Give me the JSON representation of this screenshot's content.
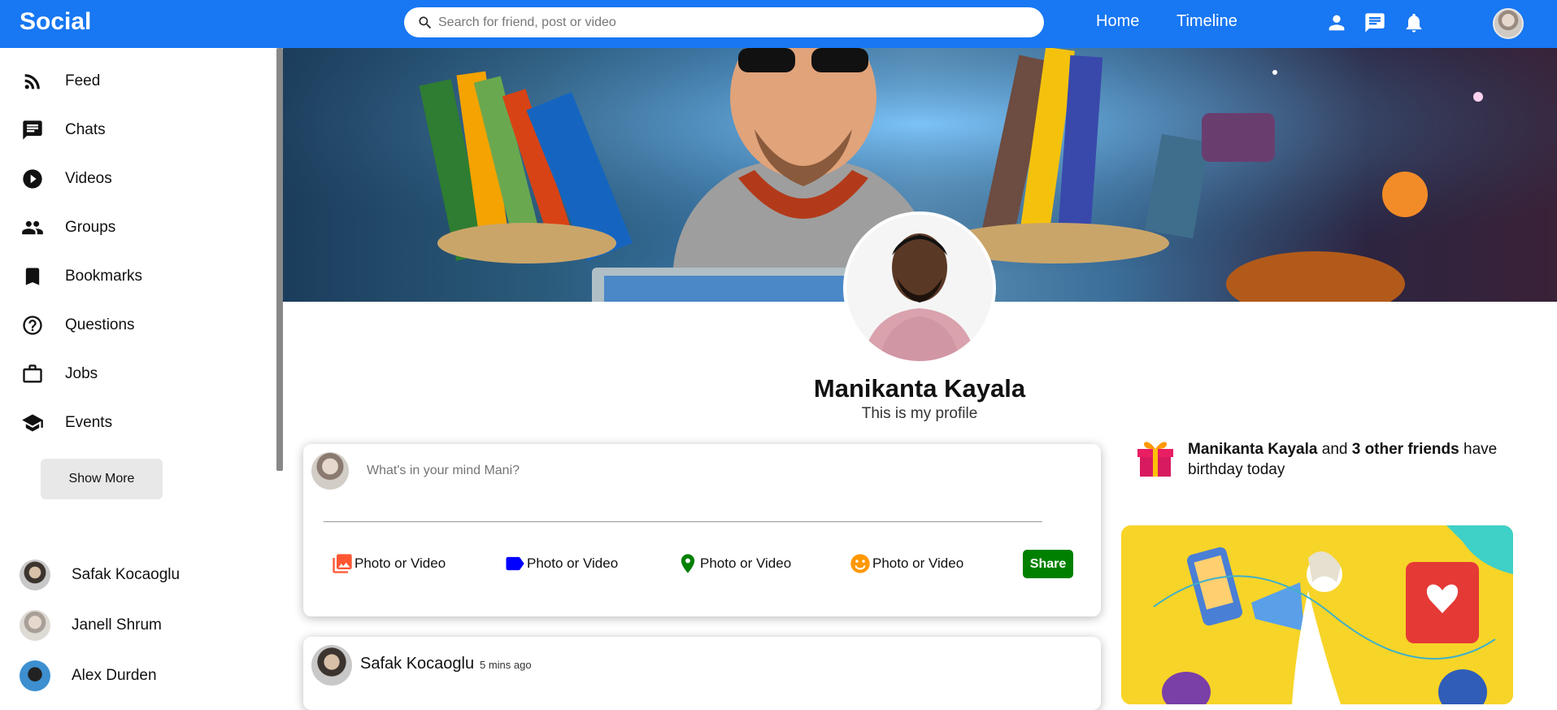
{
  "app": {
    "logo": "Social",
    "search_placeholder": "Search for friend, post or video",
    "nav": {
      "home": "Home",
      "timeline": "Timeline"
    }
  },
  "sidebar": {
    "items": [
      {
        "label": "Feed",
        "icon": "rss-feed-icon"
      },
      {
        "label": "Chats",
        "icon": "chat-icon"
      },
      {
        "label": "Videos",
        "icon": "play-circle-icon"
      },
      {
        "label": "Groups",
        "icon": "group-icon"
      },
      {
        "label": "Bookmarks",
        "icon": "bookmark-icon"
      },
      {
        "label": "Questions",
        "icon": "help-circle-icon"
      },
      {
        "label": "Jobs",
        "icon": "briefcase-icon"
      },
      {
        "label": "Events",
        "icon": "school-icon"
      }
    ],
    "show_more": "Show More",
    "friends": [
      {
        "name": "Safak Kocaoglu"
      },
      {
        "name": "Janell Shrum"
      },
      {
        "name": "Alex Durden"
      }
    ]
  },
  "profile": {
    "name": "Manikanta Kayala",
    "description": "This is my profile"
  },
  "share": {
    "placeholder": "What's in your mind Mani?",
    "options": [
      {
        "label": "Photo or Video",
        "icon": "photo-library-icon",
        "color": "#ff5733"
      },
      {
        "label": "Photo or Video",
        "icon": "label-icon",
        "color": "#0000ff"
      },
      {
        "label": "Photo or Video",
        "icon": "location-pin-icon",
        "color": "#008000"
      },
      {
        "label": "Photo or Video",
        "icon": "emoji-icon",
        "color": "#ff9800"
      }
    ],
    "button": "Share"
  },
  "post": {
    "user": "Safak Kocaoglu",
    "time": "5 mins ago"
  },
  "rightbar": {
    "birthday": {
      "name": "Manikanta Kayala",
      "connector": "and",
      "others": "3 other friends",
      "suffix": "have birthday today"
    }
  },
  "colors": {
    "topbar": "#1877f2",
    "share_button": "#008000",
    "ad_background": "#f7d428"
  }
}
